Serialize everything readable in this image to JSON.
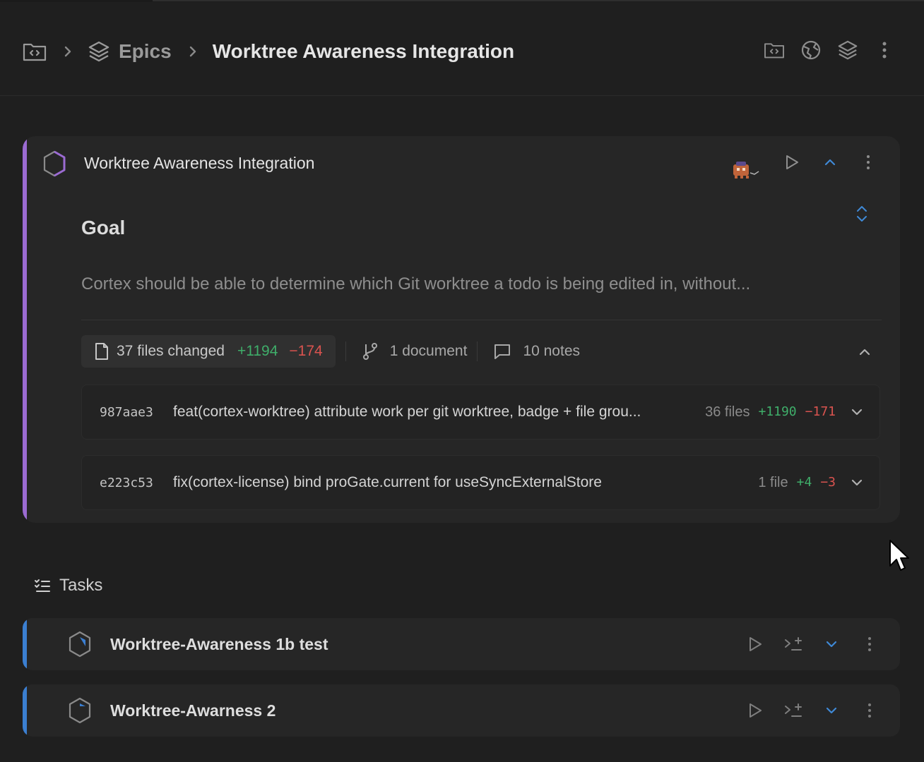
{
  "breadcrumb": {
    "root_icon": "folder-code-icon",
    "section_label": "Epics",
    "current_title": "Worktree Awareness Integration"
  },
  "header_actions": [
    "folder-code-icon",
    "globe-icon",
    "layers-icon",
    "more-vertical-icon"
  ],
  "epic": {
    "title": "Worktree Awareness Integration",
    "goal_heading": "Goal",
    "goal_text": "Cortex should be able to determine which Git worktree a todo is being edited in, without...",
    "files_changed": "37 files changed",
    "additions": "+1194",
    "deletions": "−174",
    "documents": "1 document",
    "notes": "10 notes",
    "accent_color": "#9b6bd2",
    "commits": [
      {
        "hash": "987aae3",
        "message": "feat(cortex-worktree) attribute work per git worktree, badge + file grou...",
        "files": "36 files",
        "additions": "+1190",
        "deletions": "−171"
      },
      {
        "hash": "e223c53",
        "message": "fix(cortex-license) bind proGate.current for useSyncExternalStore",
        "files": "1 file",
        "additions": "+4",
        "deletions": "−3"
      }
    ]
  },
  "tasks": {
    "heading": "Tasks",
    "accent_color": "#3b7fd1",
    "items": [
      {
        "title": "Worktree-Awareness 1b test"
      },
      {
        "title": "Worktree-Awarness 2"
      }
    ]
  }
}
